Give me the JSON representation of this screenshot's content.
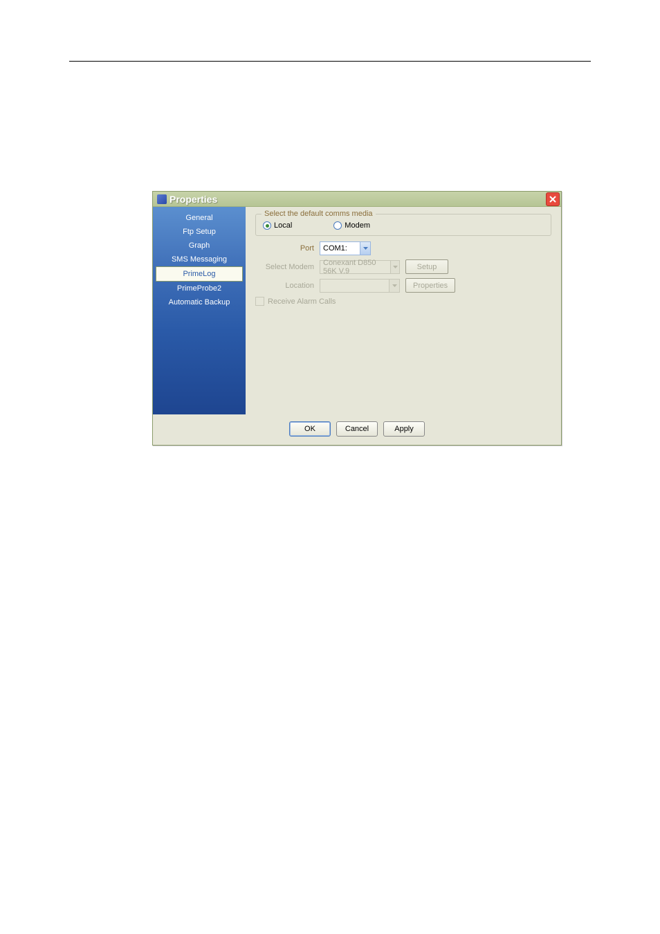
{
  "dialog": {
    "title": "Properties"
  },
  "sidebar": {
    "items": [
      {
        "label": "General"
      },
      {
        "label": "Ftp Setup"
      },
      {
        "label": "Graph"
      },
      {
        "label": "SMS Messaging"
      },
      {
        "label": "PrimeLog"
      },
      {
        "label": "PrimeProbe2"
      },
      {
        "label": "Automatic Backup"
      }
    ],
    "selected_index": 4
  },
  "content": {
    "group_title": "Select the default comms media",
    "radio_local": "Local",
    "radio_modem": "Modem",
    "port_label": "Port",
    "port_value": "COM1:",
    "select_modem_label": "Select Modem",
    "select_modem_value": "Conexant D850 56K V.9",
    "location_label": "Location",
    "location_value": "",
    "setup_btn": "Setup",
    "properties_btn": "Properties",
    "receive_alarm_label": "Receive Alarm Calls"
  },
  "footer": {
    "ok": "OK",
    "cancel": "Cancel",
    "apply": "Apply"
  }
}
